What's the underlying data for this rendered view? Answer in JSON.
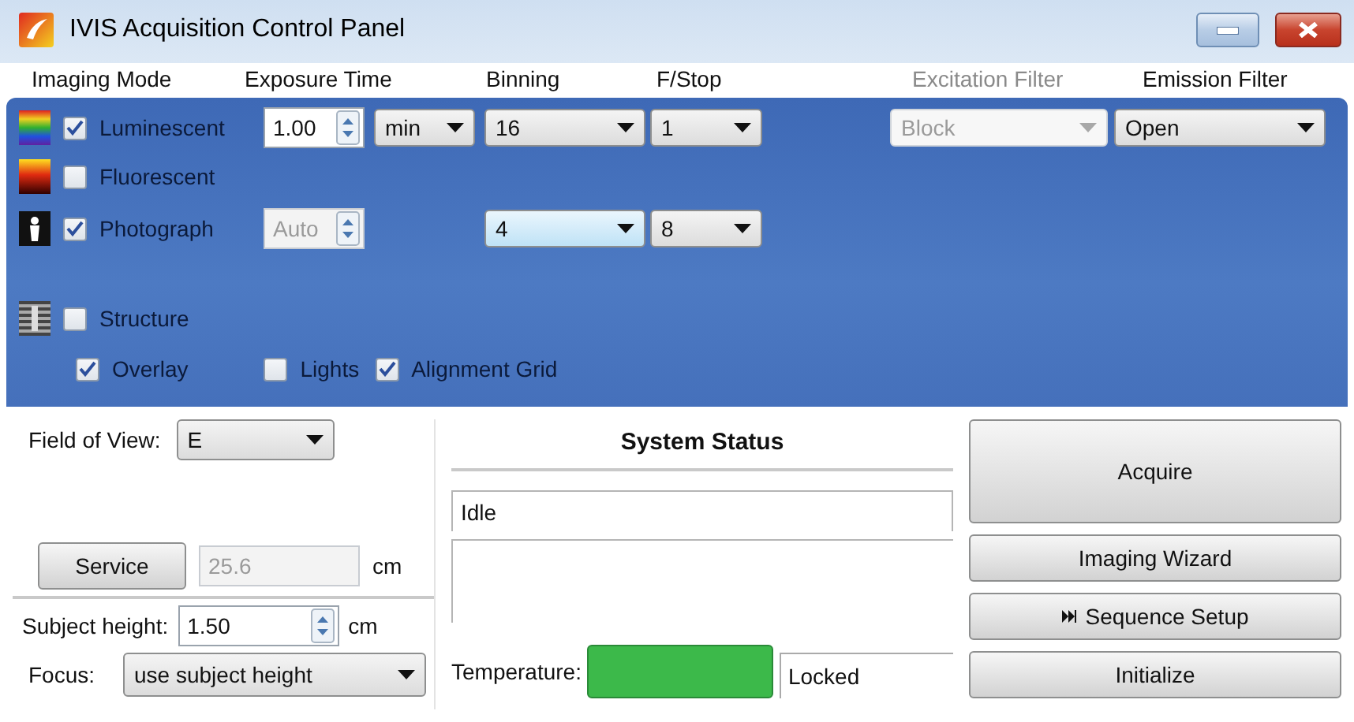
{
  "window": {
    "title": "IVIS Acquisition Control Panel"
  },
  "column_headers": [
    {
      "label": "Imaging Mode",
      "disabled": false
    },
    {
      "label": "Exposure Time",
      "disabled": false
    },
    {
      "label": "Binning",
      "disabled": false
    },
    {
      "label": "F/Stop",
      "disabled": false
    },
    {
      "label": "Excitation Filter",
      "disabled": true
    },
    {
      "label": "Emission Filter",
      "disabled": false
    }
  ],
  "imaging_modes": [
    {
      "kind": "luminescent",
      "label": "Luminescent",
      "checked": true,
      "exposure": {
        "value": "1.00",
        "disabled": false
      },
      "unit": "min",
      "binning": {
        "value": "16",
        "focused": false
      },
      "fstop": "1",
      "excitation": {
        "value": "Block",
        "disabled": true
      },
      "emission": "Open"
    },
    {
      "kind": "fluorescent",
      "label": "Fluorescent",
      "checked": false
    },
    {
      "kind": "photograph",
      "label": "Photograph",
      "checked": true,
      "exposure": {
        "value": "Auto",
        "disabled": true
      },
      "binning": {
        "value": "4",
        "focused": true
      },
      "fstop": "8"
    },
    {
      "kind": "structure",
      "label": "Structure",
      "checked": false
    }
  ],
  "options": [
    {
      "label": "Overlay",
      "checked": true
    },
    {
      "label": "Lights",
      "checked": false
    },
    {
      "label": "Alignment Grid",
      "checked": true
    }
  ],
  "field_of_view": {
    "label": "Field of View:",
    "value": "E"
  },
  "service": {
    "button": "Service",
    "value": "25.6",
    "disabled": true,
    "unit": "cm"
  },
  "subject_height": {
    "label": "Subject height:",
    "value": "1.50",
    "unit": "cm"
  },
  "focus": {
    "label": "Focus:",
    "value": "use subject height"
  },
  "system_status": {
    "title": "System Status",
    "status": "Idle",
    "temperature_label": "Temperature:",
    "temperature_indicator": {
      "color": "#3cb94a"
    },
    "lock_state": "Locked"
  },
  "buttons": [
    {
      "label": "Acquire",
      "kind": "large"
    },
    {
      "label": "Imaging Wizard",
      "kind": "normal"
    },
    {
      "label": "Sequence Setup",
      "kind": "sequence"
    },
    {
      "label": "Initialize",
      "kind": "normal"
    }
  ]
}
